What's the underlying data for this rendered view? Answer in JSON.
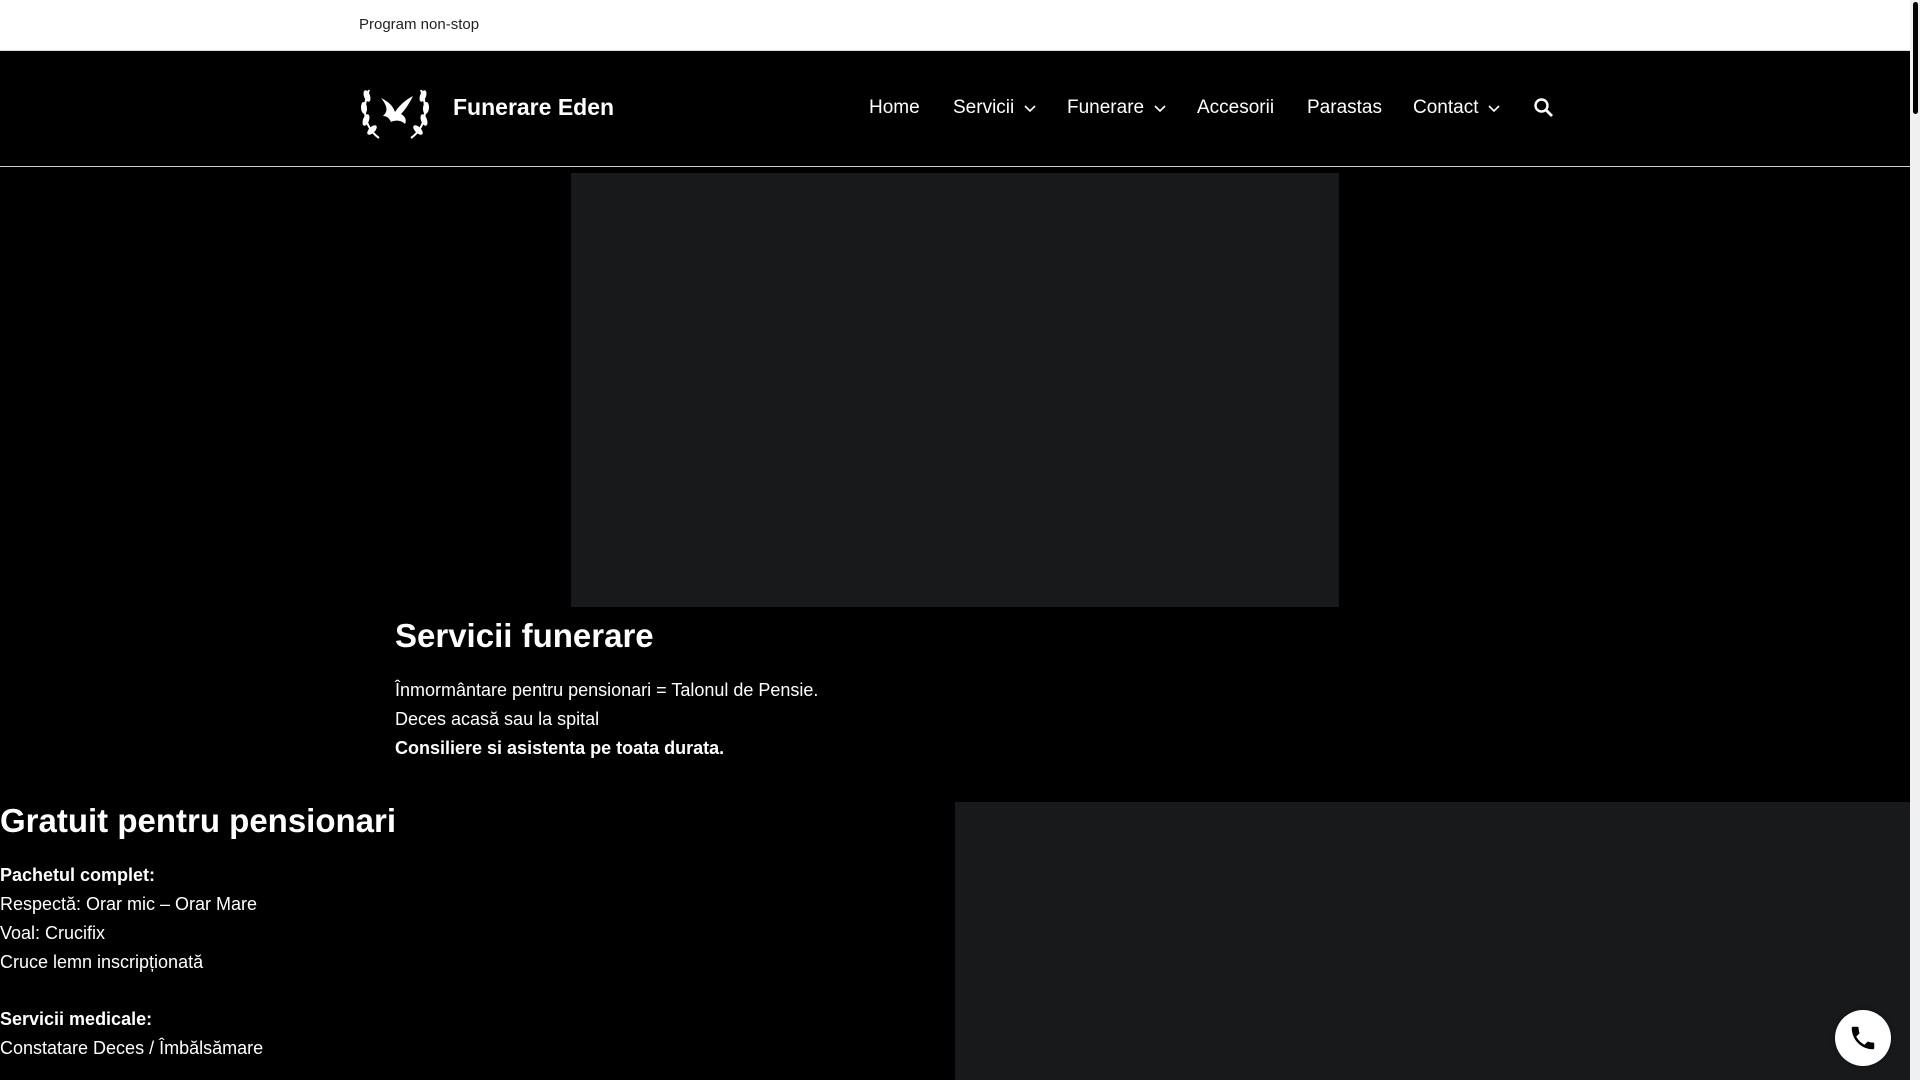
{
  "topbar": {
    "schedule": "Program non-stop"
  },
  "header": {
    "site_title": "Funerare Eden",
    "logo_icon": "dove-laurel-logo-icon",
    "nav": [
      {
        "label": "Home",
        "has_dropdown": false
      },
      {
        "label": "Servicii",
        "has_dropdown": true
      },
      {
        "label": "Funerare",
        "has_dropdown": true
      },
      {
        "label": "Accesorii",
        "has_dropdown": false
      },
      {
        "label": "Parastas",
        "has_dropdown": false
      },
      {
        "label": "Contact",
        "has_dropdown": true
      }
    ],
    "search_icon": "search-icon"
  },
  "hero": {
    "title": "Servicii funerare",
    "lines": [
      "Înmormântare pentru pensionari = Talonul de Pensie.",
      "Deces acasă sau la spital",
      "Consiliere si asistenta pe toata durata."
    ]
  },
  "pensioners": {
    "title": "Gratuit pentru pensionari",
    "package_heading": "Pachetul complet:",
    "package_items": [
      "Respectă: Orar mic – Orar Mare",
      "Voal: Crucifix",
      "Cruce lemn inscripționată"
    ],
    "medical_heading": "Servicii medicale:",
    "medical_items": [
      "Constatare Deces / Îmbălsămare"
    ]
  },
  "call_button_icon": "phone-icon",
  "colors": {
    "background": "#000000",
    "topbar": "#ffffff",
    "image_placeholder": "#18191b"
  }
}
